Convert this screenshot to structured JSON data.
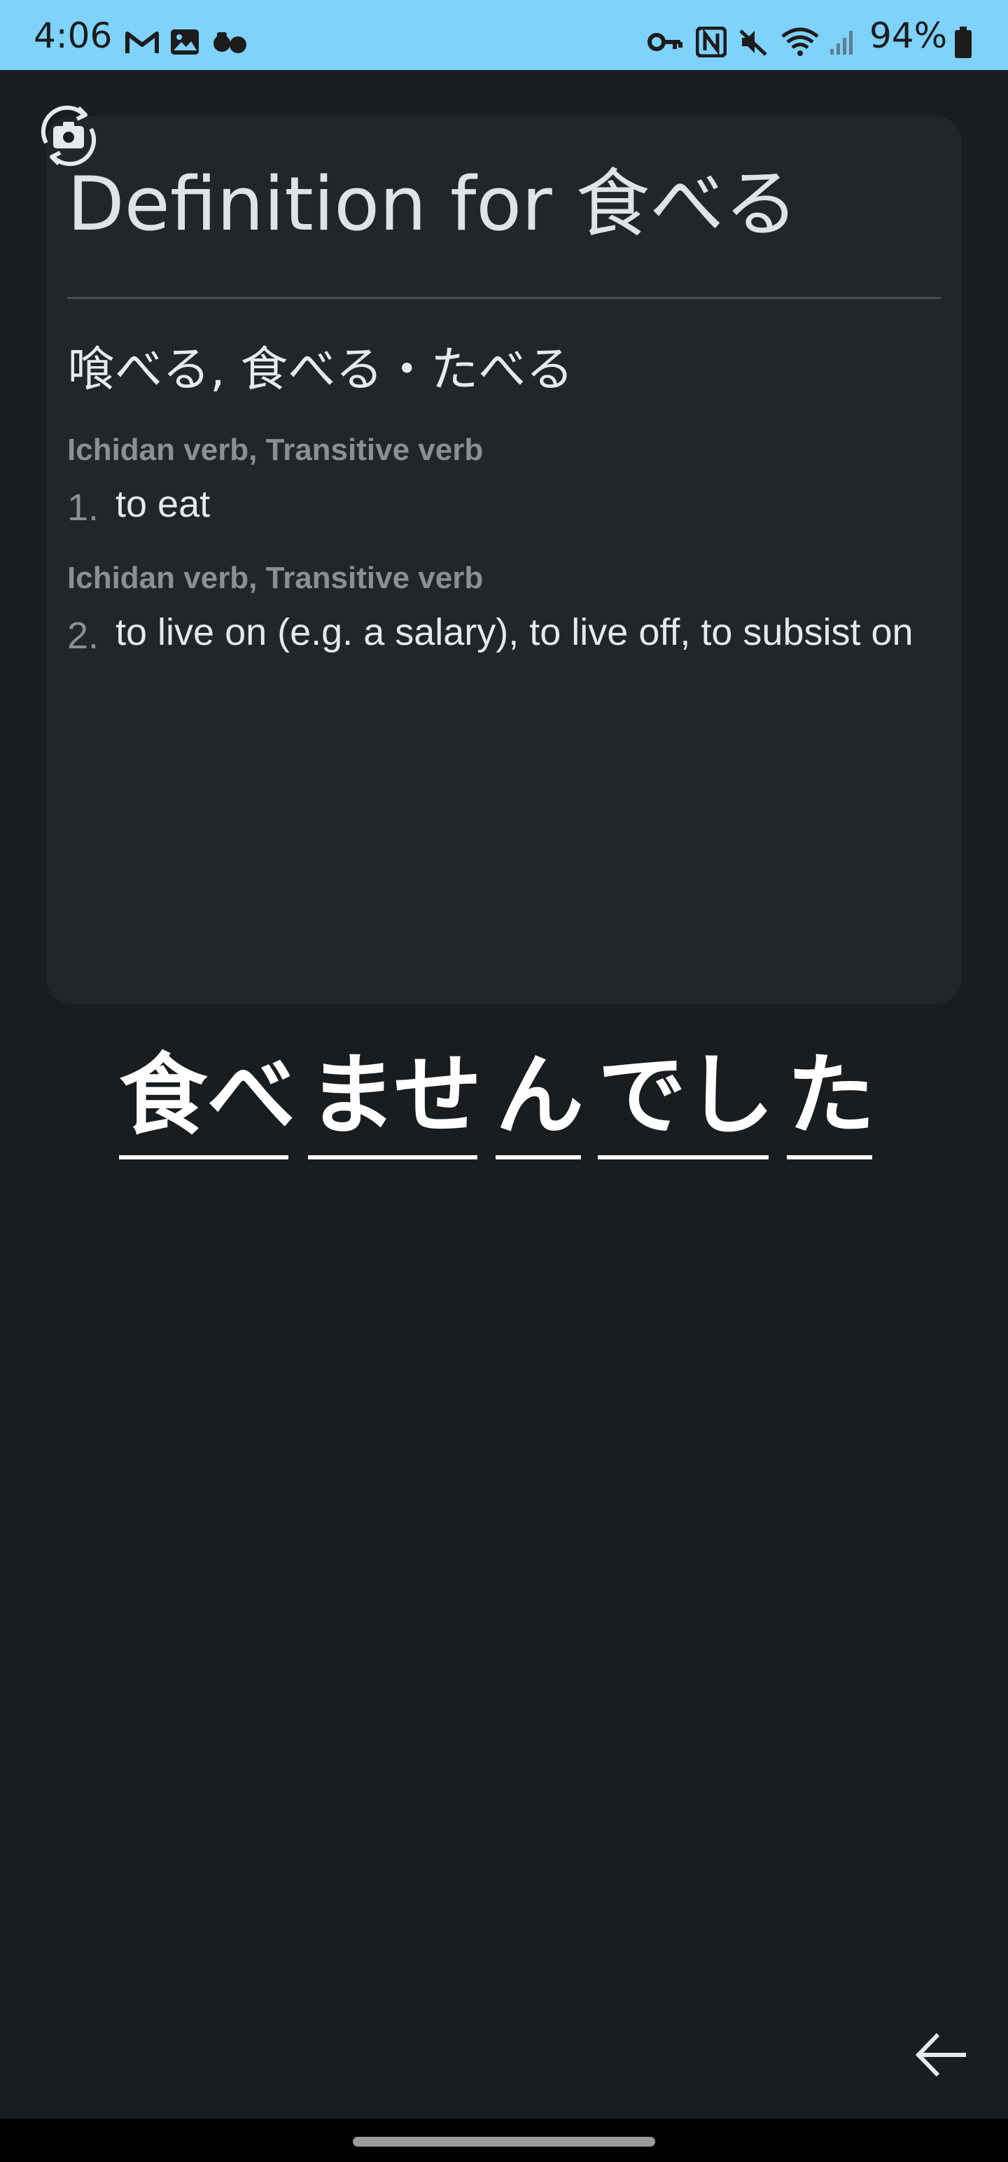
{
  "status_bar": {
    "time": "4:06",
    "battery_percent": "94%",
    "left_icons": [
      "gmail-icon",
      "gallery-icon",
      "app-icon"
    ],
    "right_icons": [
      "vpn-key-icon",
      "nfc-icon",
      "mute-icon",
      "wifi-icon",
      "signal-icon",
      "battery-icon"
    ],
    "background_color": "#7ed2fc"
  },
  "rotate_button": {
    "icon": "screen-rotate-icon"
  },
  "definition_card": {
    "title": "Definition for 食べる",
    "reading": "喰べる, 食べる・たべる",
    "senses": [
      {
        "pos": "Ichidan verb, Transitive verb",
        "number": "1.",
        "gloss": "to eat"
      },
      {
        "pos": "Ichidan verb, Transitive verb",
        "number": "2.",
        "gloss": "to live on (e.g. a salary), to live off, to subsist on"
      }
    ]
  },
  "sentence": {
    "tokens": [
      "食べ",
      "ませ",
      "ん",
      "でし",
      "た"
    ]
  },
  "back_button": {
    "icon": "arrow-back-icon"
  },
  "colors": {
    "background": "#1a1d20",
    "card": "#202629",
    "muted_text": "#8b9094",
    "text": "#e6e9eb"
  }
}
